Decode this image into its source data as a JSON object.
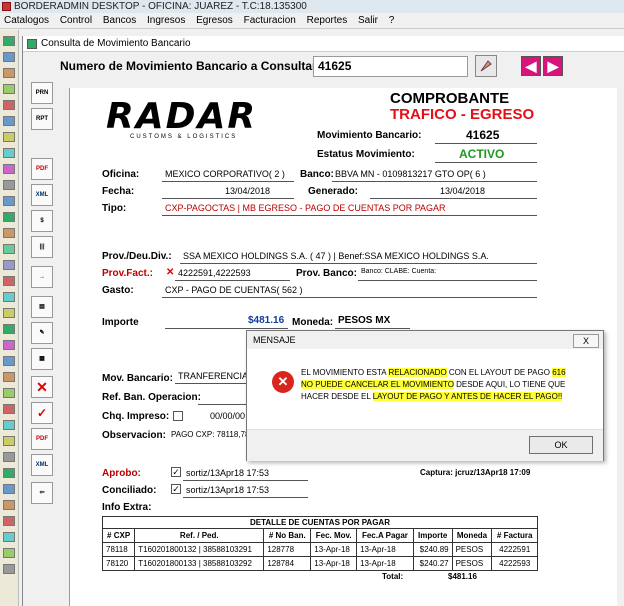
{
  "app": {
    "title": "BORDERADMIN DESKTOP - OFICINA: JUAREZ - T.C:18.135300",
    "menu": [
      "Catalogos",
      "Control",
      "Bancos",
      "Ingresos",
      "Egresos",
      "Facturacion",
      "Reportes",
      "Salir",
      "?"
    ]
  },
  "window": {
    "title": "Consulta de Movimiento Bancario",
    "num_label": "Numero de Movimiento Bancario a Consultar:",
    "num_value": "41625"
  },
  "doc": {
    "logo": "RADAR",
    "logo_sub": "CUSTOMS & LOGISTICS",
    "heading": "COMPROBANTE",
    "tipo_heading": "TRAFICO - EGRESO",
    "mov_banc_label": "Movimiento Bancario:",
    "mov_banc_value": "41625",
    "estatus_label": "Estatus Movimiento:",
    "estatus_value": "ACTIVO",
    "oficina_label": "Oficina:",
    "oficina_value": "MEXICO CORPORATIVO( 2 )",
    "banco_label": "Banco:",
    "banco_value": "BBVA MN - 0109813217 GTO OP( 6 )",
    "fecha_label": "Fecha:",
    "fecha_value": "13/04/2018",
    "generado_label": "Generado:",
    "generado_value": "13/04/2018",
    "tipo_label": "Tipo:",
    "tipo_value": "CXP-PAGOCTAS | MB EGRESO - PAGO DE CUENTAS POR PAGAR",
    "prov_label": "Prov./Deu.Div.:",
    "prov_value": "SSA MEXICO HOLDINGS S.A. ( 47 ) | Benef:SSA MEXICO HOLDINGS S.A.",
    "provfact_label": "Prov.Fact.:",
    "provfact_value": "4222591,4222593",
    "provbanco_label": "Prov. Banco:",
    "provbanco_value": "Banco: CLABE: Cuenta:",
    "gasto_label": "Gasto:",
    "gasto_value": "CXP - PAGO DE CUENTAS( 562 )",
    "importe_label": "Importe",
    "importe_value": "$481.16",
    "moneda_label": "Moneda:",
    "moneda_value": "PESOS MX",
    "movbanc_label": "Mov. Bancario:",
    "movbanc_value": "TRANFERENCIA",
    "refban_label": "Ref. Ban. Operacion:",
    "chq_label": "Chq. Impreso:",
    "chq_value": "00/00/00",
    "obs_label": "Observacion:",
    "obs_value": "PAGO CXP: 78118,78",
    "aprobo_label": "Aprobo:",
    "aprobo_value": "sortiz/13Apr18 17:53",
    "captura_value": "Captura: jcruz/13Apr18 17:09",
    "conciliado_label": "Conciliado:",
    "conciliado_value": "sortiz/13Apr18 17:53",
    "info_label": "Info Extra:"
  },
  "table": {
    "title": "DETALLE DE CUENTAS POR PAGAR",
    "headers": [
      "# CXP",
      "Ref. / Ped.",
      "# No Ban.",
      "Fec. Mov.",
      "Fec.A Pagar",
      "Importe",
      "Moneda",
      "# Factura"
    ],
    "rows": [
      [
        "78118",
        "T160201800132 | 38588103291",
        "128778",
        "13-Apr-18",
        "13-Apr-18",
        "$240.89",
        "PESOS",
        "4222591"
      ],
      [
        "78120",
        "T160201800133 | 38588103292",
        "128784",
        "13-Apr-18",
        "13-Apr-18",
        "$240.27",
        "PESOS",
        "4222593"
      ]
    ],
    "total_label": "Total:",
    "total_value": "$481.16"
  },
  "dialog": {
    "title": "MENSAJE",
    "close_label": "X",
    "msg1": "EL MOVIMIENTO ESTA ",
    "msg_hl1": "RELACIONADO",
    "msg2": " CON EL LAYOUT DE PAGO ",
    "msg_hl2": "616",
    "msg3": "NO PUEDE CANCELAR EL MOVIMIENTO",
    "msg4": " DESDE AQUI, LO TIENE QUE HACER DESDE EL ",
    "msg_hl3": "LAYOUT DE PAGO Y ANTES DE HACER EL PAGO!!",
    "ok_label": "OK"
  }
}
